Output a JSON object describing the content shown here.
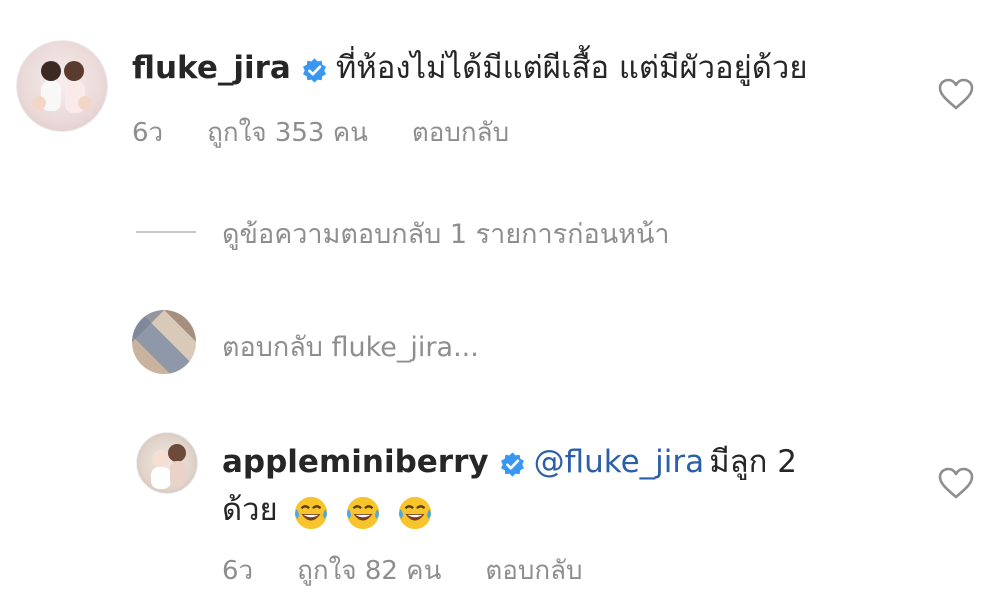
{
  "comment": {
    "username": "fluke_jira",
    "text": "ที่ห้องไม่ได้มีแต่ผีเสื้อ แต่มีผัวอยู่ด้วย",
    "time": "6ว",
    "likes": "ถูกใจ 353 คน",
    "reply_label": "ตอบกลับ"
  },
  "view_replies": "ดูข้อความตอบกลับ 1 รายการก่อนหน้า",
  "replying": {
    "prefix": "ตอบกลับ",
    "target": "fluke_jira..."
  },
  "reply": {
    "username": "appleminiberry",
    "mention": "@fluke_jira",
    "text_line1": "มีลูก 2",
    "text_line2": "ด้วย",
    "emoji_icons": [
      "face-with-tears-of-joy-icon",
      "face-with-tears-of-joy-icon",
      "face-with-tears-of-joy-icon"
    ],
    "time": "6ว",
    "likes": "ถูกใจ 82 คน",
    "reply_label": "ตอบกลับ"
  },
  "colors": {
    "verified": "#3897f0",
    "mention": "#2b5fa8",
    "meta": "#8e8e8e"
  }
}
